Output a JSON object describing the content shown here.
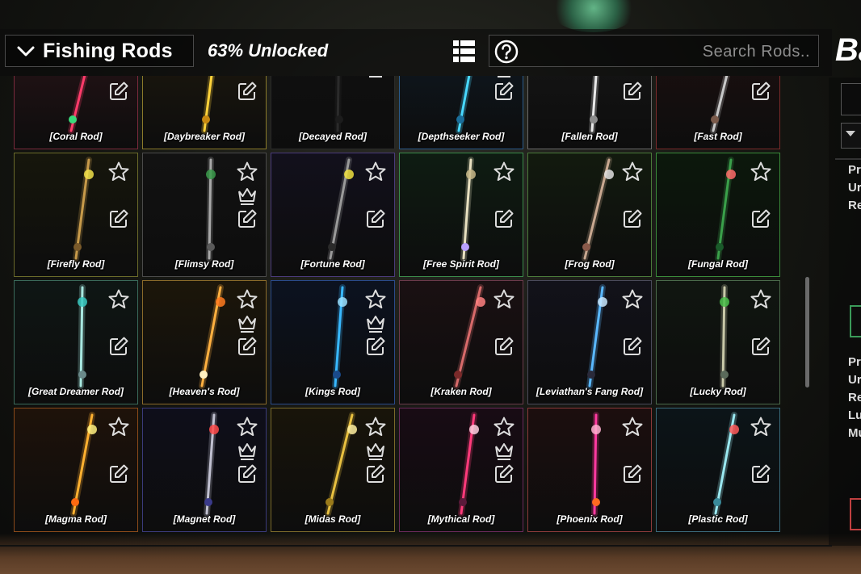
{
  "header": {
    "category": "Fishing Rods",
    "unlocked": "63% Unlocked",
    "search_placeholder": "Search Rods..",
    "side_heading": "Ba",
    "icons": [
      "chevron-down-icon",
      "grid-view-icon",
      "help-icon"
    ]
  },
  "right_panel": {
    "section1_lines": [
      "Pr",
      "Ur",
      "Re"
    ],
    "section2_lines": [
      "Pr",
      "Ur",
      "Re",
      "Lu",
      "Mu"
    ]
  },
  "rods": [
    {
      "name": "[Coral Rod]",
      "border": "#7a2a3c",
      "tint": "#2a1418",
      "colors": [
        "#ff3b6a",
        "#39d97a",
        "#7a5cff"
      ],
      "icons": [
        "edit-icon"
      ]
    },
    {
      "name": "[Daybreaker Rod]",
      "border": "#8a7a2a",
      "tint": "#1f1a0d",
      "colors": [
        "#ffd23a",
        "#c88a12",
        "#fff0a0"
      ],
      "icons": [
        "edit-icon"
      ]
    },
    {
      "name": "[Decayed Rod]",
      "border": "#2a2a2a",
      "tint": "#111111",
      "colors": [
        "#2b2b2b",
        "#1c1c1c",
        "#3a3a3a"
      ],
      "icons": [
        "crown-icon"
      ]
    },
    {
      "name": "[Depthseeker Rod]",
      "border": "#2a5a8a",
      "tint": "#0e1a24",
      "colors": [
        "#48d8ff",
        "#1a6e9a",
        "#b8f4ff"
      ],
      "icons": [
        "crown-icon",
        "edit-icon"
      ]
    },
    {
      "name": "[Fallen Rod]",
      "border": "#6a6a6a",
      "tint": "#171717",
      "colors": [
        "#e8e8e8",
        "#8c8c8c",
        "#ffffff"
      ],
      "icons": [
        "edit-icon"
      ]
    },
    {
      "name": "[Fast Rod]",
      "border": "#7a2a2a",
      "tint": "#1e1010",
      "colors": [
        "#c8c8c8",
        "#7a5a4a",
        "#ff4040"
      ],
      "icons": [
        "edit-icon"
      ]
    },
    {
      "name": "[Firefly Rod]",
      "border": "#6a6a2a",
      "tint": "#16160c",
      "colors": [
        "#c79a4a",
        "#7a5a2a",
        "#f0e04a"
      ],
      "icons": [
        "star-icon",
        "edit-icon"
      ]
    },
    {
      "name": "[Flimsy Rod]",
      "border": "#4a4a4a",
      "tint": "#121212",
      "colors": [
        "#a8a8a8",
        "#5a5a5a",
        "#3a9a4a"
      ],
      "icons": [
        "star-icon",
        "crown-icon",
        "edit-icon"
      ]
    },
    {
      "name": "[Fortune Rod]",
      "border": "#4a3a7a",
      "tint": "#12101c",
      "colors": [
        "#9a9a9a",
        "#2a2a2a",
        "#f0e040"
      ],
      "icons": [
        "star-icon",
        "edit-icon"
      ]
    },
    {
      "name": "[Free Spirit Rod]",
      "border": "#3a8a4a",
      "tint": "#0e1c12",
      "colors": [
        "#e8e0c0",
        "#b9a0ff",
        "#c8b888"
      ],
      "icons": [
        "star-icon",
        "edit-icon"
      ]
    },
    {
      "name": "[Frog Rod]",
      "border": "#4a7a3a",
      "tint": "#121a0e",
      "colors": [
        "#c8a890",
        "#8a5a4a",
        "#e0e0e0"
      ],
      "icons": [
        "star-icon",
        "edit-icon"
      ]
    },
    {
      "name": "[Fungal Rod]",
      "border": "#3a8a3a",
      "tint": "#0c180c",
      "colors": [
        "#3aa04a",
        "#1a5a2a",
        "#ff6a6a"
      ],
      "icons": [
        "star-icon",
        "edit-icon"
      ]
    },
    {
      "name": "[Great Dreamer Rod]",
      "border": "#3a6a5a",
      "tint": "#0e1614",
      "colors": [
        "#a8e8e0",
        "#6a8a8a",
        "#38c8c0"
      ],
      "icons": [
        "star-icon",
        "edit-icon"
      ]
    },
    {
      "name": "[Heaven's Rod]",
      "border": "#8a6a2a",
      "tint": "#1c160a",
      "colors": [
        "#ffb040",
        "#fff0c0",
        "#ff7a20"
      ],
      "icons": [
        "star-icon",
        "crown-icon",
        "edit-icon"
      ]
    },
    {
      "name": "[Kings Rod]",
      "border": "#2a4a8a",
      "tint": "#0c1220",
      "colors": [
        "#38b8ff",
        "#1a4a8a",
        "#9ae0ff"
      ],
      "icons": [
        "star-icon",
        "crown-icon",
        "edit-icon"
      ]
    },
    {
      "name": "[Kraken Rod]",
      "border": "#6a3a4a",
      "tint": "#1a1012",
      "colors": [
        "#d86a6a",
        "#7a2a2a",
        "#ff8080"
      ],
      "icons": [
        "star-icon",
        "edit-icon"
      ]
    },
    {
      "name": "[Leviathan's Fang Rod]",
      "border": "#4a4a5a",
      "tint": "#12121a",
      "colors": [
        "#5ab8ff",
        "#2a2a3a",
        "#c8e8ff"
      ],
      "icons": [
        "star-icon",
        "edit-icon"
      ]
    },
    {
      "name": "[Lucky Rod]",
      "border": "#4a6a4a",
      "tint": "#101610",
      "colors": [
        "#c8c8a8",
        "#5a6a5a",
        "#4ac04a"
      ],
      "icons": [
        "star-icon",
        "edit-icon"
      ]
    },
    {
      "name": "[Magma Rod]",
      "border": "#8a4a1a",
      "tint": "#1e120a",
      "colors": [
        "#ffb030",
        "#ff6a10",
        "#fff080"
      ],
      "icons": [
        "star-icon",
        "edit-icon"
      ]
    },
    {
      "name": "[Magnet Rod]",
      "border": "#3a3a7a",
      "tint": "#0e0e1a",
      "colors": [
        "#c0c0d0",
        "#3a3a8a",
        "#ff4a4a"
      ],
      "icons": [
        "star-icon",
        "crown-icon",
        "edit-icon"
      ]
    },
    {
      "name": "[Midas Rod]",
      "border": "#7a6a2a",
      "tint": "#18140a",
      "colors": [
        "#e8c040",
        "#9a7a1a",
        "#fff0a0"
      ],
      "icons": [
        "star-icon",
        "crown-icon",
        "edit-icon"
      ]
    },
    {
      "name": "[Mythical Rod]",
      "border": "#6a2a5a",
      "tint": "#180c14",
      "colors": [
        "#ff3a7a",
        "#5a1a3a",
        "#ffd0e0"
      ],
      "icons": [
        "star-icon",
        "crown-icon",
        "edit-icon"
      ]
    },
    {
      "name": "[Phoenix Rod]",
      "border": "#8a3a3a",
      "tint": "#1c0e0e",
      "colors": [
        "#ff3aa0",
        "#ff6a20",
        "#ffb0d0"
      ],
      "icons": [
        "star-icon",
        "edit-icon"
      ]
    },
    {
      "name": "[Plastic Rod]",
      "border": "#3a6a7a",
      "tint": "#0c1418",
      "colors": [
        "#9ae8f0",
        "#3a8a9a",
        "#ff5a5a"
      ],
      "icons": [
        "star-icon",
        "edit-icon"
      ]
    }
  ]
}
